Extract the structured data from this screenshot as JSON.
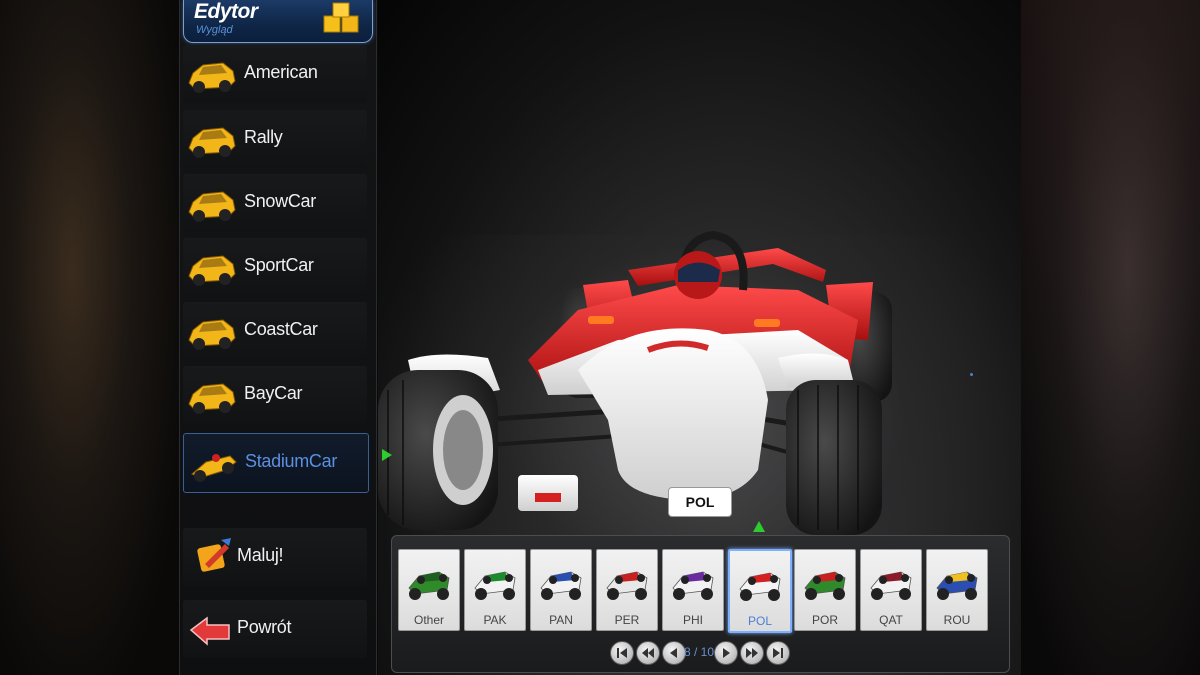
{
  "editor": {
    "title": "Edytor",
    "subtitle": "Wygląd",
    "cubes_icon": "cubes-icon"
  },
  "car_list": [
    {
      "label": "American",
      "icon": "american-car-icon",
      "selected": false
    },
    {
      "label": "Rally",
      "icon": "rally-car-icon",
      "selected": false
    },
    {
      "label": "SnowCar",
      "icon": "snow-car-icon",
      "selected": false
    },
    {
      "label": "SportCar",
      "icon": "sport-car-icon",
      "selected": false
    },
    {
      "label": "CoastCar",
      "icon": "coast-car-icon",
      "selected": false
    },
    {
      "label": "BayCar",
      "icon": "bay-car-icon",
      "selected": false
    },
    {
      "label": "StadiumCar",
      "icon": "stadium-car-icon",
      "selected": true
    }
  ],
  "actions": {
    "paint_label": "Maluj!",
    "paint_icon": "paint-bucket-icon",
    "back_label": "Powrót",
    "back_icon": "back-arrow-icon"
  },
  "car_plate": "POL",
  "skins": [
    {
      "label": "Other",
      "body": "#2f8a2a",
      "accent": "#1f5f1f",
      "selected": false
    },
    {
      "label": "PAK",
      "body": "#f2f2f2",
      "accent": "#1e8a2e",
      "selected": false
    },
    {
      "label": "PAN",
      "body": "#f2f2f2",
      "accent": "#2b4fb0",
      "selected": false
    },
    {
      "label": "PER",
      "body": "#e8e8e8",
      "accent": "#c82020",
      "selected": false
    },
    {
      "label": "PHI",
      "body": "#f2f2f2",
      "accent": "#6a2aa0",
      "selected": false
    },
    {
      "label": "POL",
      "body": "#f4f4f4",
      "accent": "#d42020",
      "selected": true
    },
    {
      "label": "POR",
      "body": "#2e8a2a",
      "accent": "#c82020",
      "selected": false
    },
    {
      "label": "QAT",
      "body": "#f2f2f2",
      "accent": "#8a1a2a",
      "selected": false
    },
    {
      "label": "ROU",
      "body": "#2b4fb0",
      "accent": "#f0c020",
      "selected": false
    }
  ],
  "pager": {
    "text": "8 / 10",
    "buttons": [
      "first-page-icon",
      "fast-back-icon",
      "prev-icon",
      "next-icon",
      "fast-forward-icon",
      "last-page-icon"
    ]
  },
  "colors": {
    "accent_blue": "#5b8fe0",
    "header_bg": "#0f2646",
    "car_icon_yellow": "#f2b619",
    "selection_marker_green": "#2ecc2e"
  }
}
